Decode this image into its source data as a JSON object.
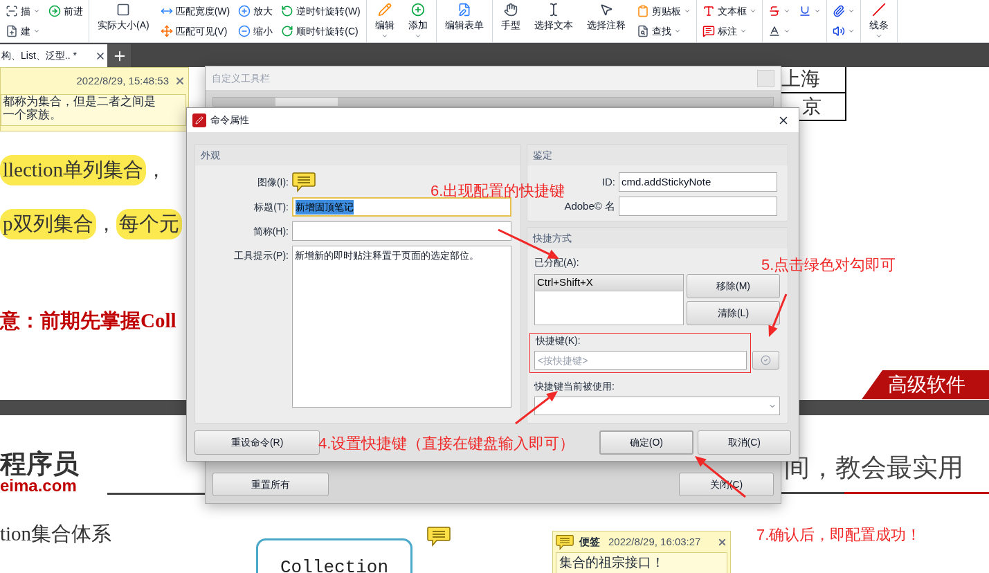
{
  "toolbar": {
    "groups": [
      {
        "columns": [
          {
            "kind": "stack",
            "items": [
              {
                "label": "描",
                "dropdown": true
              },
              {
                "label": "建",
                "dropdown": true
              }
            ]
          },
          {
            "kind": "stack",
            "items": [
              {
                "label": "前进",
                "dropdown": false
              }
            ]
          }
        ]
      },
      {
        "columns": [
          {
            "kind": "large",
            "items": [
              {
                "label": "实际大小(A)",
                "dropdown": false
              }
            ]
          },
          {
            "kind": "stack",
            "items": [
              {
                "label": "匹配宽度(W)",
                "dropdown": false
              },
              {
                "label": "匹配可见(V)",
                "dropdown": false
              }
            ]
          },
          {
            "kind": "stack",
            "items": [
              {
                "label": "放大",
                "dropdown": false
              },
              {
                "label": "缩小",
                "dropdown": false
              }
            ]
          },
          {
            "kind": "stack",
            "items": [
              {
                "label": "逆时针旋转(W)",
                "dropdown": false
              },
              {
                "label": "顺时针旋转(C)",
                "dropdown": false
              }
            ]
          }
        ]
      },
      {
        "columns": [
          {
            "kind": "large",
            "items": [
              {
                "label": "编辑",
                "dropdown": true
              }
            ]
          },
          {
            "kind": "large",
            "items": [
              {
                "label": "添加",
                "dropdown": true
              }
            ]
          }
        ]
      },
      {
        "columns": [
          {
            "kind": "large",
            "items": [
              {
                "label": "编辑表单",
                "dropdown": false
              }
            ]
          }
        ]
      },
      {
        "columns": [
          {
            "kind": "large",
            "items": [
              {
                "label": "手型",
                "dropdown": false
              }
            ]
          },
          {
            "kind": "large",
            "items": [
              {
                "label": "选择文本",
                "dropdown": false
              }
            ]
          },
          {
            "kind": "large",
            "items": [
              {
                "label": "选择注释",
                "dropdown": false
              }
            ]
          },
          {
            "kind": "stack",
            "items": [
              {
                "label": "剪贴板",
                "dropdown": true
              },
              {
                "label": "查找",
                "dropdown": true
              }
            ]
          }
        ]
      },
      {
        "columns": [
          {
            "kind": "stack",
            "items": [
              {
                "label": "文本框",
                "dropdown": true
              },
              {
                "label": "标注",
                "dropdown": true
              }
            ]
          }
        ]
      },
      {
        "columns": [
          {
            "kind": "stack",
            "items": [
              {
                "dropdown": true
              },
              {
                "dropdown": true
              }
            ]
          },
          {
            "kind": "stack",
            "items": [
              {
                "dropdown": true
              }
            ]
          }
        ]
      },
      {
        "columns": [
          {
            "kind": "stack",
            "items": [
              {
                "dropdown": true
              },
              {
                "dropdown": true
              }
            ]
          }
        ]
      },
      {
        "columns": [
          {
            "kind": "large",
            "items": [
              {
                "label": "线条",
                "dropdown": true
              }
            ]
          }
        ]
      }
    ]
  },
  "tabs": [
    {
      "label": "构、List、泛型.. *",
      "selected": true
    }
  ],
  "page_1": {
    "note": {
      "time": "2022/8/29, 15:48:53",
      "lines": [
        "都称为集合，但是二者之间是",
        "一个家族。"
      ]
    },
    "lines": [
      {
        "kind": "body",
        "segments": [
          {
            "text": "llection单列集合",
            "highlight": true
          },
          {
            "text": "，",
            "highlight": false
          }
        ]
      },
      {
        "kind": "body",
        "segments": [
          {
            "text": "p双列集合",
            "highlight": true
          },
          {
            "text": "，",
            "highlight": false
          },
          {
            "text": "每个元",
            "highlight": true
          }
        ]
      },
      {
        "kind": "emphasis",
        "segments": [
          {
            "text": "意：前期先掌握Coll",
            "highlight": false
          }
        ]
      }
    ],
    "table": [
      "上海",
      "京"
    ],
    "banner": "高级软件"
  },
  "page_2": {
    "logo_name": "程序员",
    "logo_site": "eima.com",
    "slogan": "间，教会最实用",
    "heading": "tion集合体系",
    "diagram_node": "Collection",
    "note": {
      "title": "便签",
      "time": "2022/8/29, 16:03:27",
      "text": "集合的祖宗接口！"
    }
  },
  "toolbar_dialog": {
    "title": "自定义工具栏",
    "active": false,
    "buttons": [
      "重置所有",
      "关闭(C)"
    ]
  },
  "command_dialog": {
    "title": "命令属性",
    "appearance": {
      "heading": "外观",
      "image_label": "图像(I):",
      "fields": [
        {
          "kind": "line",
          "label": "标题(T):",
          "value": "新增固顶笔记",
          "focused": true
        },
        {
          "kind": "line",
          "label": "简称(H):",
          "focused": false
        },
        {
          "kind": "multiline",
          "label": "工具提示(P):",
          "value": "新增新的即时贴注释置于页面的选定部位。",
          "focused": false
        }
      ]
    },
    "identity": {
      "heading": "鉴定",
      "fields": [
        {
          "label": "ID:",
          "value": "cmd.addStickyNote"
        },
        {
          "label": "Adobe© 名"
        }
      ]
    },
    "shortcuts": {
      "heading": "快捷方式",
      "assigned_label": "已分配(A):",
      "assigned": [
        {
          "label": "Ctrl+Shift+X",
          "selected": true
        }
      ],
      "side_buttons": [
        "移除(M)",
        "清除(L)"
      ],
      "key_label": "快捷键(K):",
      "key_placeholder": "<按快捷键>",
      "apply_disabled": true,
      "in_use_label": "快捷键当前被使用:"
    },
    "buttons": [
      {
        "label": "重设命令(R)",
        "default": false
      },
      {
        "label": "确定(O)",
        "default": true
      },
      {
        "label": "取消(C)",
        "default": false
      }
    ]
  },
  "annotations": [
    "6.出现配置的快捷键",
    "5.点击绿色对勾即可",
    "4.设置快捷键（直接在键盘输入即可）",
    "7.确认后，即配置成功！"
  ]
}
